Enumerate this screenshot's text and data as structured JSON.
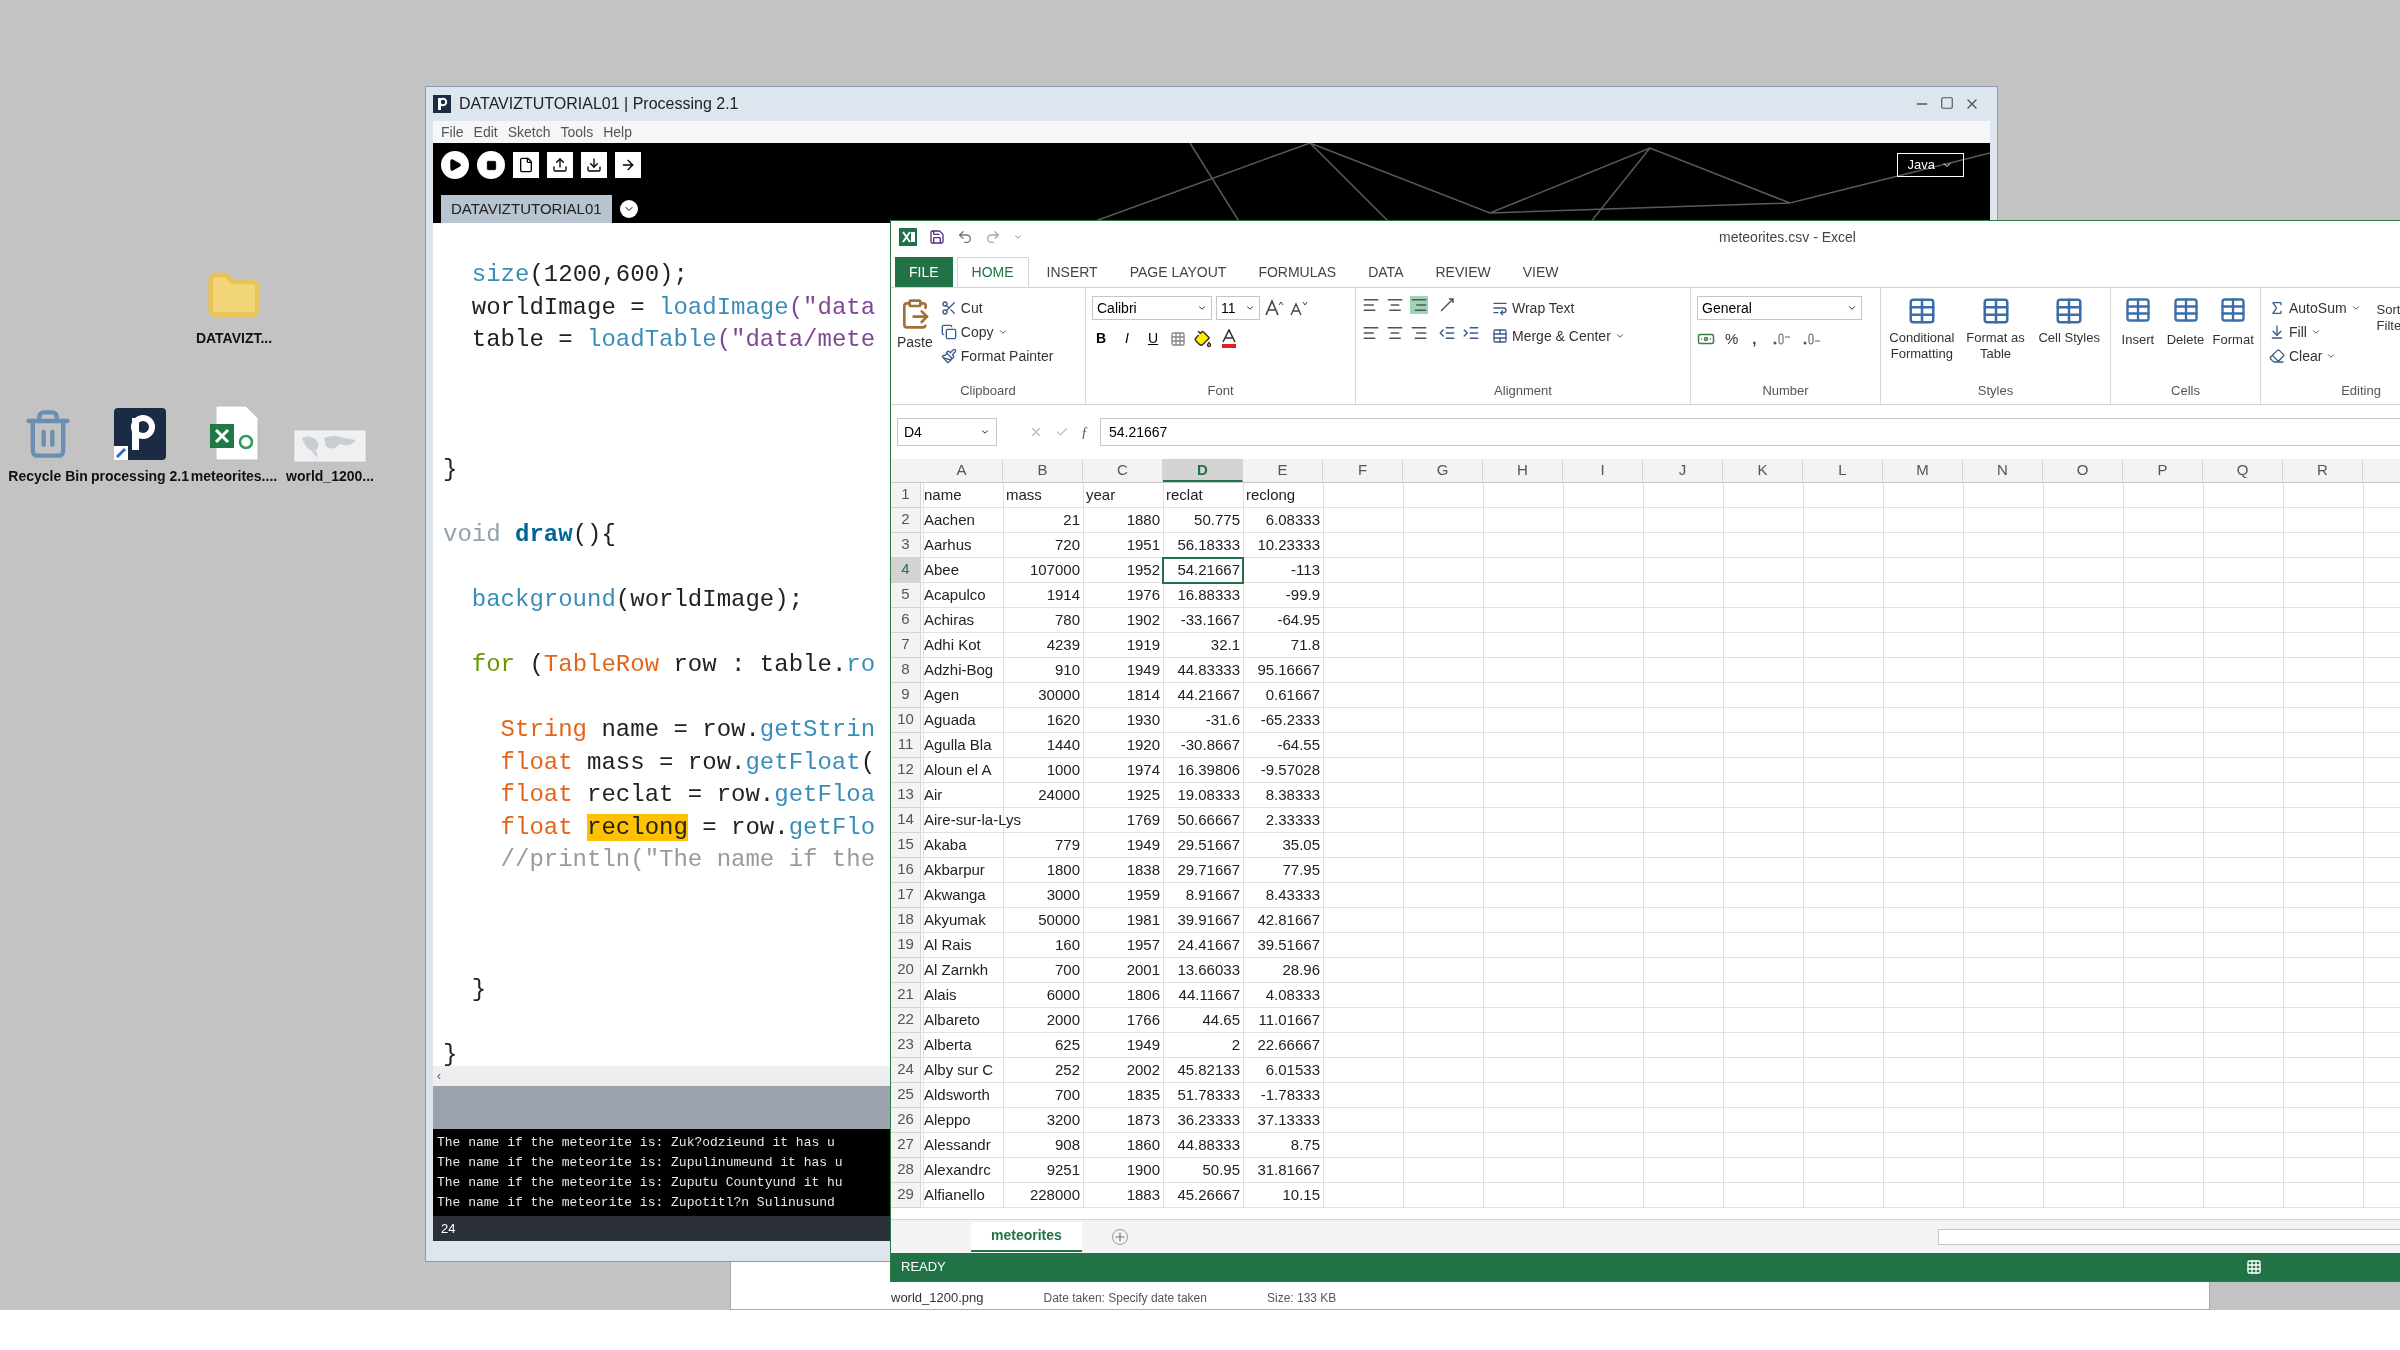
{
  "desktop": {
    "icons": [
      {
        "label": "DATAVIZT...",
        "kind": "folder"
      },
      {
        "label": "Recycle Bin",
        "kind": "bin"
      },
      {
        "label": "processing 2.1",
        "kind": "processing"
      },
      {
        "label": "meteorites....",
        "kind": "spreadsheet"
      },
      {
        "label": "world_1200...",
        "kind": "image"
      }
    ]
  },
  "explorer": {
    "file_name": "world_1200.png",
    "date": "Date taken: Specify date taken",
    "size": "Size: 133 KB"
  },
  "processing": {
    "title": "DATAVIZTUTORIAL01 | Processing 2.1",
    "menu": [
      "File",
      "Edit",
      "Sketch",
      "Tools",
      "Help"
    ],
    "tabs": [
      {
        "label": "DATAVIZTUTORIAL01",
        "selected": true
      }
    ],
    "mode": "Java",
    "code": [
      {
        "tokens": [
          {
            "t": "  size",
            "color": "#3a8db8"
          },
          {
            "t": "(1200,600);"
          }
        ]
      },
      {
        "tokens": [
          {
            "t": "  worldImage = "
          },
          {
            "t": "loadImage",
            "color": "#3a8db8"
          },
          {
            "t": "(\"data",
            "color": "#7d4793"
          }
        ]
      },
      {
        "tokens": [
          {
            "t": "  table = "
          },
          {
            "t": "loadTable",
            "color": "#3a8db8"
          },
          {
            "t": "(\"data/mete",
            "color": "#7d4793"
          }
        ]
      },
      {
        "kind": "blank"
      },
      {
        "kind": "blank"
      },
      {
        "kind": "blank"
      },
      {
        "tokens": [
          {
            "t": "}"
          }
        ]
      },
      {
        "kind": "blank"
      },
      {
        "tokens": [
          {
            "t": "void ",
            "color": "#8fa3ad"
          },
          {
            "t": "draw",
            "color": "#006699",
            "bold": true
          },
          {
            "t": "(){"
          }
        ]
      },
      {
        "kind": "blank"
      },
      {
        "tokens": [
          {
            "t": "  background",
            "color": "#3a8db8"
          },
          {
            "t": "(worldImage);"
          }
        ]
      },
      {
        "kind": "blank"
      },
      {
        "tokens": [
          {
            "t": "  for",
            "color": "#669900"
          },
          {
            "t": " ("
          },
          {
            "t": "TableRow",
            "color": "#e2661a"
          },
          {
            "t": " row : table."
          },
          {
            "t": "ro",
            "color": "#3a8db8"
          }
        ]
      },
      {
        "kind": "blank"
      },
      {
        "tokens": [
          {
            "t": "    String",
            "color": "#e2661a"
          },
          {
            "t": " name = row."
          },
          {
            "t": "getStrin",
            "color": "#3a8db8"
          }
        ]
      },
      {
        "tokens": [
          {
            "t": "    float",
            "color": "#e2661a"
          },
          {
            "t": " mass = row."
          },
          {
            "t": "getFloat",
            "color": "#3a8db8"
          },
          {
            "t": "("
          }
        ]
      },
      {
        "tokens": [
          {
            "t": "    float",
            "color": "#e2661a"
          },
          {
            "t": " reclat = row."
          },
          {
            "t": "getFloa",
            "color": "#3a8db8"
          }
        ]
      },
      {
        "tokens": [
          {
            "t": "    float ",
            "color": "#e2661a"
          },
          {
            "t": "reclong",
            "highlight": true
          },
          {
            "t": " = row."
          },
          {
            "t": "getFlo",
            "color": "#3a8db8"
          }
        ]
      },
      {
        "tokens": [
          {
            "t": "    //println(\"The name if the",
            "color": "#9a9a9a"
          }
        ]
      },
      {
        "kind": "blank"
      },
      {
        "kind": "blank"
      },
      {
        "kind": "blank"
      },
      {
        "tokens": [
          {
            "t": "  }"
          }
        ]
      },
      {
        "kind": "blank"
      },
      {
        "tokens": [
          {
            "t": "}"
          }
        ]
      }
    ],
    "scroll_arrow": "‹",
    "console": [
      "The name if the meteorite is: Zuk?odzieund it has u",
      "The name if the meteorite is: Zupulinumeund it has u",
      "The name if the meteorite is: Zuputu Countyund it hu",
      "The name if the meteorite is: Zupotitl?n Sulinusund"
    ],
    "line_number": "24"
  },
  "excel": {
    "title": "meteorites.csv - Excel",
    "tabs": [
      {
        "label": "FILE",
        "kind": "file",
        "selected": false
      },
      {
        "label": "HOME",
        "selected": true
      },
      {
        "label": "INSERT",
        "selected": false
      },
      {
        "label": "PAGE LAYOUT",
        "selected": false
      },
      {
        "label": "FORMULAS",
        "selected": false
      },
      {
        "label": "DATA",
        "selected": false
      },
      {
        "label": "REVIEW",
        "selected": false
      },
      {
        "label": "VIEW",
        "selected": false
      }
    ],
    "clipboard": {
      "label": "Clipboard",
      "paste": "Paste",
      "cut": "Cut",
      "copy": "Copy",
      "format_painter": "Format Painter"
    },
    "font": {
      "label": "Font",
      "name": "Calibri",
      "size": "11",
      "bold": "B",
      "italic": "I",
      "underline": "U"
    },
    "alignment": {
      "label": "Alignment",
      "wrap": "Wrap Text",
      "merge": "Merge & Center"
    },
    "number": {
      "label": "Number",
      "format": "General",
      "percent": "%",
      "comma": ","
    },
    "styles": {
      "label": "Styles",
      "items": [
        "Conditional Formatting",
        "Format as Table",
        "Cell Styles"
      ]
    },
    "cells": {
      "label": "Cells",
      "items": [
        "Insert",
        "Delete",
        "Format"
      ]
    },
    "editing": {
      "label": "Editing",
      "autosum": "AutoSum",
      "fill": "Fill",
      "clear": "Clear",
      "sort": "Sort",
      "filter": "Filte"
    },
    "name_box": "D4",
    "function_symbol": "ƒ",
    "formula": "54.21667",
    "columns": [
      {
        "label": "A",
        "selected": false
      },
      {
        "label": "B",
        "selected": false
      },
      {
        "label": "C",
        "selected": false
      },
      {
        "label": "D",
        "selected": true
      },
      {
        "label": "E",
        "selected": false
      },
      {
        "label": "F",
        "selected": false
      },
      {
        "label": "G",
        "selected": false
      },
      {
        "label": "H",
        "selected": false
      },
      {
        "label": "I",
        "selected": false
      },
      {
        "label": "J",
        "selected": false
      },
      {
        "label": "K",
        "selected": false
      },
      {
        "label": "L",
        "selected": false
      },
      {
        "label": "M",
        "selected": false
      },
      {
        "label": "N",
        "selected": false
      },
      {
        "label": "O",
        "selected": false
      },
      {
        "label": "P",
        "selected": false
      },
      {
        "label": "Q",
        "selected": false
      },
      {
        "label": "R",
        "selected": false
      }
    ],
    "rows": [
      {
        "header": "1",
        "selected": false,
        "cells": [
          "name",
          "mass",
          "year",
          "reclat",
          "reclong"
        ]
      },
      {
        "header": "2",
        "selected": false,
        "cells": [
          "Aachen",
          "21",
          "1880",
          "50.775",
          "6.08333"
        ]
      },
      {
        "header": "3",
        "selected": false,
        "cells": [
          "Aarhus",
          "720",
          "1951",
          "56.18333",
          "10.23333"
        ]
      },
      {
        "header": "4",
        "selected": true,
        "cells": [
          "Abee",
          "107000",
          "1952",
          "54.21667",
          "-113"
        ]
      },
      {
        "header": "5",
        "selected": false,
        "cells": [
          "Acapulco",
          "1914",
          "1976",
          "16.88333",
          "-99.9"
        ]
      },
      {
        "header": "6",
        "selected": false,
        "cells": [
          "Achiras",
          "780",
          "1902",
          "-33.1667",
          "-64.95"
        ]
      },
      {
        "header": "7",
        "selected": false,
        "cells": [
          "Adhi Kot",
          "4239",
          "1919",
          "32.1",
          "71.8"
        ]
      },
      {
        "header": "8",
        "selected": false,
        "cells": [
          "Adzhi-Bog",
          "910",
          "1949",
          "44.83333",
          "95.16667"
        ]
      },
      {
        "header": "9",
        "selected": false,
        "cells": [
          "Agen",
          "30000",
          "1814",
          "44.21667",
          "0.61667"
        ]
      },
      {
        "header": "10",
        "selected": false,
        "cells": [
          "Aguada",
          "1620",
          "1930",
          "-31.6",
          "-65.2333"
        ]
      },
      {
        "header": "11",
        "selected": false,
        "cells": [
          "Agulla Bla",
          "1440",
          "1920",
          "-30.8667",
          "-64.55"
        ]
      },
      {
        "header": "12",
        "selected": false,
        "cells": [
          "Aloun el A",
          "1000",
          "1974",
          "16.39806",
          "-9.57028"
        ]
      },
      {
        "header": "13",
        "selected": false,
        "cells": [
          "Air",
          "24000",
          "1925",
          "19.08333",
          "8.38333"
        ]
      },
      {
        "header": "14",
        "selected": false,
        "cells": [
          "Aire-sur-la-Lys",
          null,
          "1769",
          "50.66667",
          "2.33333"
        ]
      },
      {
        "header": "15",
        "selected": false,
        "cells": [
          "Akaba",
          "779",
          "1949",
          "29.51667",
          "35.05"
        ]
      },
      {
        "header": "16",
        "selected": false,
        "cells": [
          "Akbarpur",
          "1800",
          "1838",
          "29.71667",
          "77.95"
        ]
      },
      {
        "header": "17",
        "selected": false,
        "cells": [
          "Akwanga",
          "3000",
          "1959",
          "8.91667",
          "8.43333"
        ]
      },
      {
        "header": "18",
        "selected": false,
        "cells": [
          "Akyumak",
          "50000",
          "1981",
          "39.91667",
          "42.81667"
        ]
      },
      {
        "header": "19",
        "selected": false,
        "cells": [
          "Al Rais",
          "160",
          "1957",
          "24.41667",
          "39.51667"
        ]
      },
      {
        "header": "20",
        "selected": false,
        "cells": [
          "Al Zarnkh",
          "700",
          "2001",
          "13.66033",
          "28.96"
        ]
      },
      {
        "header": "21",
        "selected": false,
        "cells": [
          "Alais",
          "6000",
          "1806",
          "44.11667",
          "4.08333"
        ]
      },
      {
        "header": "22",
        "selected": false,
        "cells": [
          "Albareto",
          "2000",
          "1766",
          "44.65",
          "11.01667"
        ]
      },
      {
        "header": "23",
        "selected": false,
        "cells": [
          "Alberta",
          "625",
          "1949",
          "2",
          "22.66667"
        ]
      },
      {
        "header": "24",
        "selected": false,
        "cells": [
          "Alby sur C",
          "252",
          "2002",
          "45.82133",
          "6.01533"
        ]
      },
      {
        "header": "25",
        "selected": false,
        "cells": [
          "Aldsworth",
          "700",
          "1835",
          "51.78333",
          "-1.78333"
        ]
      },
      {
        "header": "26",
        "selected": false,
        "cells": [
          "Aleppo",
          "3200",
          "1873",
          "36.23333",
          "37.13333"
        ]
      },
      {
        "header": "27",
        "selected": false,
        "cells": [
          "Alessandr",
          "908",
          "1860",
          "44.88333",
          "8.75"
        ]
      },
      {
        "header": "28",
        "selected": false,
        "cells": [
          "Alexandrc",
          "9251",
          "1900",
          "50.95",
          "31.81667"
        ]
      },
      {
        "header": "29",
        "selected": false,
        "cells": [
          "Alfianello",
          "228000",
          "1883",
          "45.26667",
          "10.15"
        ]
      }
    ],
    "sheets": [
      {
        "label": "meteorites",
        "selected": true
      }
    ],
    "status": "READY"
  }
}
